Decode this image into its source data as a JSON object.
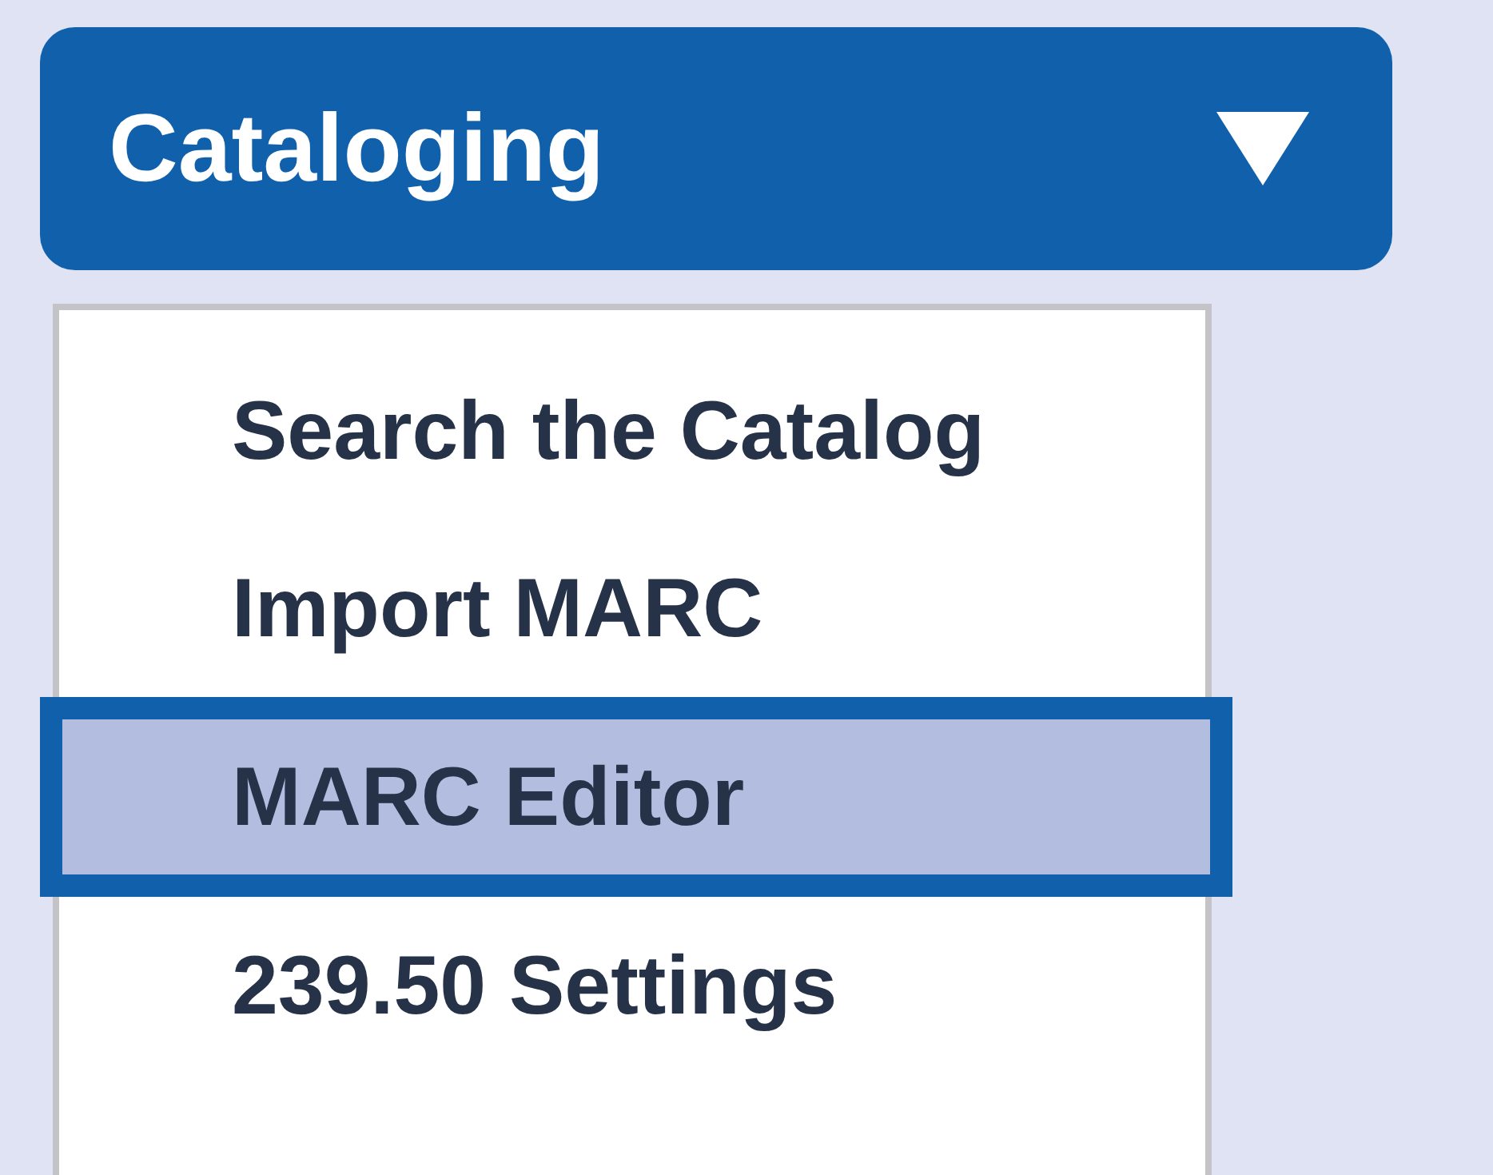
{
  "menu_button": {
    "label": "Cataloging",
    "expanded": true
  },
  "menu_items": [
    {
      "label": "Search the Catalog",
      "selected": false
    },
    {
      "label": "Import MARC",
      "selected": false
    },
    {
      "label": "MARC Editor",
      "selected": true
    },
    {
      "label": "239.50 Settings",
      "selected": false
    }
  ]
}
